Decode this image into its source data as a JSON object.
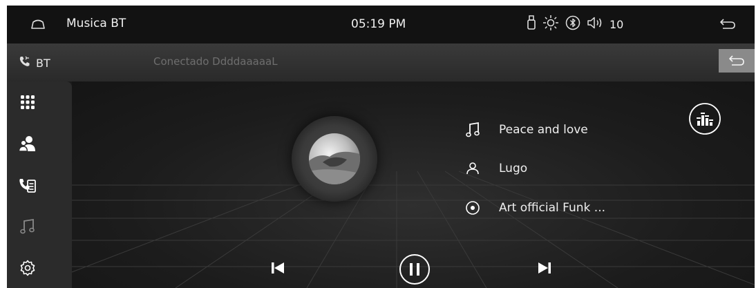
{
  "status_bar": {
    "app_title": "Musica BT",
    "time": "05:19 PM",
    "volume_value": "10",
    "icons": [
      "home-icon",
      "usb-icon",
      "brightness-icon",
      "bluetooth-icon",
      "volume-icon",
      "back-icon"
    ]
  },
  "bt_bar": {
    "label": "BT",
    "status_text": "Conectado DdddaaaaaL",
    "icons": [
      "bt-phone-icon",
      "back-icon"
    ]
  },
  "sidebar": {
    "items": [
      {
        "icon": "apps-grid-icon"
      },
      {
        "icon": "contacts-icon"
      },
      {
        "icon": "call-log-icon"
      },
      {
        "icon": "music-note-icon"
      },
      {
        "icon": "settings-icon"
      }
    ]
  },
  "track": {
    "title": "Peace and love",
    "artist": "Lugo",
    "album": "Art official Funk ..."
  },
  "controls": {
    "icons": [
      "previous-icon",
      "pause-icon",
      "next-icon",
      "equalizer-icon"
    ]
  },
  "colors": {
    "background": "#1a1a1a",
    "status_bar": "#121212",
    "bt_bar": "#333333",
    "sidebar": "#2b2b2b",
    "back_button": "#8a8a8a",
    "text": "#efefef",
    "muted_text": "#6e6e6e"
  }
}
